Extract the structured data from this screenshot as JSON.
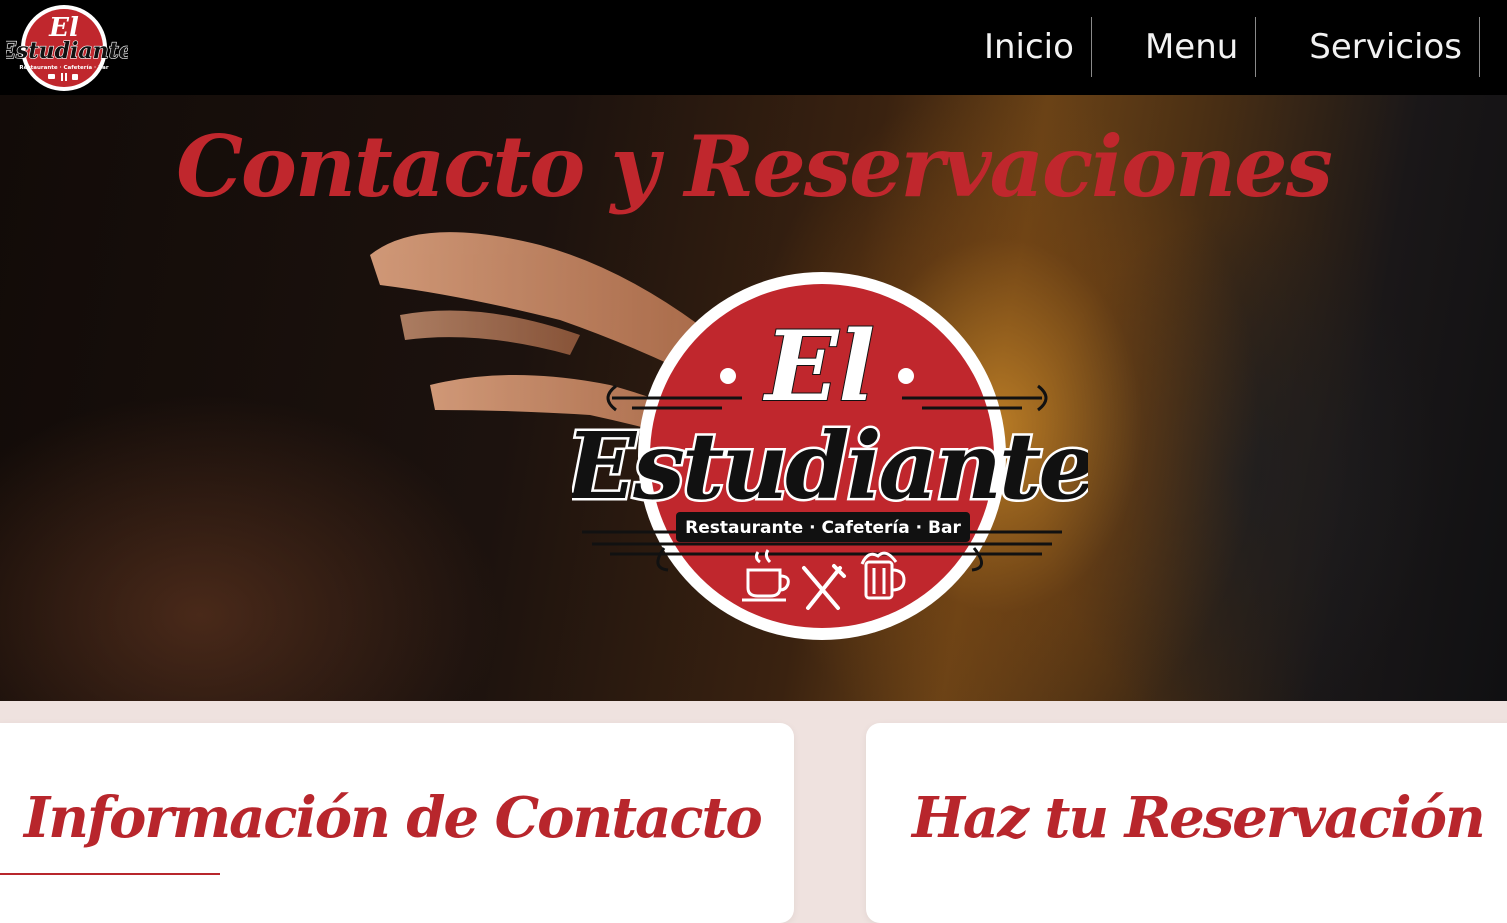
{
  "nav": {
    "links": [
      {
        "label": "Inicio"
      },
      {
        "label": "Menu"
      },
      {
        "label": "Servicios"
      }
    ]
  },
  "hero": {
    "title": "Contacto y Reservaciones"
  },
  "logo": {
    "brand_top": "El",
    "brand_main": "Estudiante",
    "tagline": "Restaurante · Cafetería · Bar",
    "icons": [
      "coffee-cup-icon",
      "fork-knife-icon",
      "beer-mug-icon"
    ]
  },
  "sections": {
    "contact_title": "Información de Contacto",
    "reservation_title": "Haz tu Reservación"
  },
  "colors": {
    "brand_red": "#c0272d",
    "nav_bg": "#000000",
    "page_bg": "#efe2df"
  }
}
